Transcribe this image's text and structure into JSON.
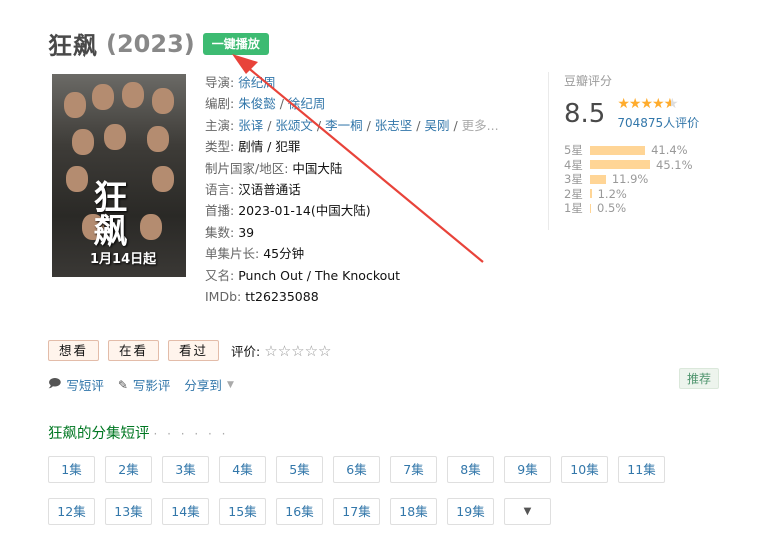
{
  "header": {
    "title": "狂飙",
    "year": "(2023)",
    "play_label": "一键播放"
  },
  "poster": {
    "big_text": "狂飙",
    "date_text": "1月14日起"
  },
  "info": {
    "director_label": "导演:",
    "director": "徐纪周",
    "writer_label": "编剧:",
    "writers": [
      "朱俊懿",
      "徐纪周"
    ],
    "cast_label": "主演:",
    "cast": [
      "张译",
      "张颂文",
      "李一桐",
      "张志坚",
      "吴刚"
    ],
    "cast_more": "更多...",
    "genre_label": "类型:",
    "genres": "剧情 / 犯罪",
    "country_label": "制片国家/地区:",
    "country": "中国大陆",
    "language_label": "语言:",
    "language": "汉语普通话",
    "premiere_label": "首播:",
    "premiere": "2023-01-14(中国大陆)",
    "episodes_label": "集数:",
    "episodes": "39",
    "runtime_label": "单集片长:",
    "runtime": "45分钟",
    "aka_label": "又名:",
    "aka": "Punch Out / The Knockout",
    "imdb_label": "IMDb:",
    "imdb": "tt26235088"
  },
  "rating": {
    "title": "豆瓣评分",
    "score": "8.5",
    "stars": 4.5,
    "count": "704875人评价",
    "breakdown": [
      {
        "label": "5星",
        "pct": "41.4%",
        "value": 41.4
      },
      {
        "label": "4星",
        "pct": "45.1%",
        "value": 45.1
      },
      {
        "label": "3星",
        "pct": "11.9%",
        "value": 11.9
      },
      {
        "label": "2星",
        "pct": "1.2%",
        "value": 1.2
      },
      {
        "label": "1星",
        "pct": "0.5%",
        "value": 0.5
      }
    ]
  },
  "actions": {
    "want": "想看",
    "watching": "在看",
    "watched": "看过",
    "eval_label": "评价:"
  },
  "links": {
    "short_review": "写短评",
    "review": "写影评",
    "share": "分享到"
  },
  "recommend_label": "推荐",
  "episodes_section": {
    "title": "狂飙的分集短评",
    "dots": "· · · · · ·",
    "items": [
      "1集",
      "2集",
      "3集",
      "4集",
      "5集",
      "6集",
      "7集",
      "8集",
      "9集",
      "10集",
      "11集",
      "12集",
      "13集",
      "14集",
      "15集",
      "16集",
      "17集",
      "18集",
      "19集"
    ]
  },
  "colors": {
    "accent_green": "#3dbb72",
    "link_blue": "#3377aa",
    "star_orange": "#ffac2d",
    "bar_fill": "#ffd596",
    "annotation_arrow": "#e8433a"
  }
}
